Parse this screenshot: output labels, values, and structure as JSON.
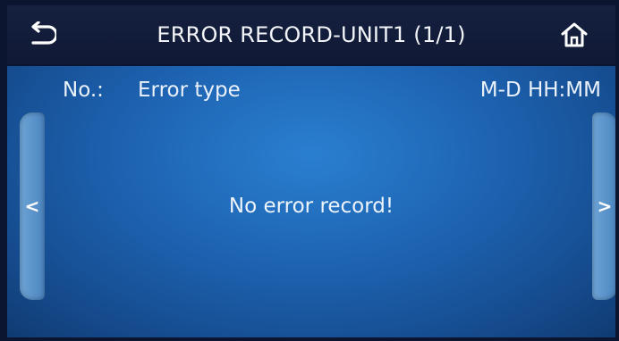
{
  "header": {
    "title": "ERROR RECORD-UNIT1 (1/1)",
    "back_icon": "back-arrow-icon",
    "home_icon": "home-icon"
  },
  "columns": {
    "number": "No.:",
    "type": "Error type",
    "time": "M-D  HH:MM"
  },
  "nav": {
    "prev_label": "<",
    "next_label": ">"
  },
  "message": "No error record!",
  "colors": {
    "header_bg": "#15203f",
    "panel_bg": "#1d62b0",
    "side_tab": "#5b93cb",
    "text": "#eef4fb"
  }
}
